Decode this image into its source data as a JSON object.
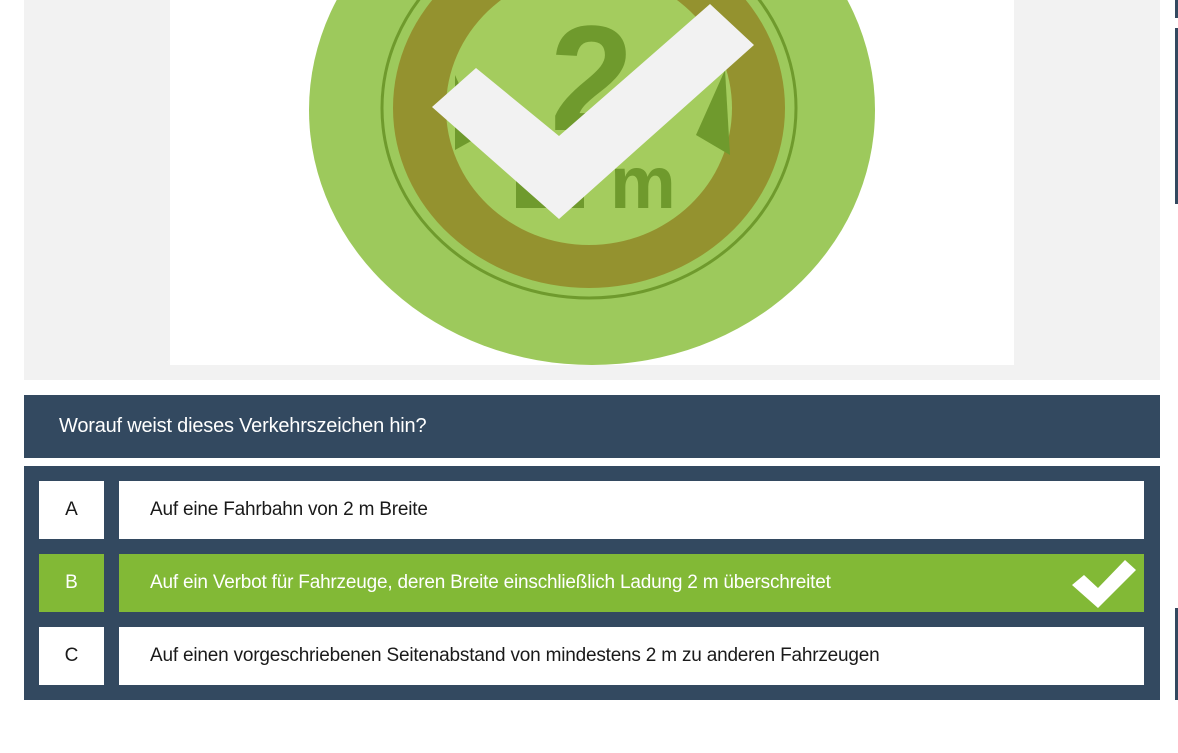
{
  "sign_image": {
    "sign_text_number": "2",
    "sign_text_unit": "m",
    "overlay_icon": "checkmark-icon",
    "colors": {
      "disc": "#9dc95c",
      "ring": "#94922f",
      "inner": "#a4cc5e",
      "glyph": "#6f9a2d",
      "check": "#f2f2f2"
    }
  },
  "question": {
    "text": "Worauf weist dieses Verkehrszeichen hin?"
  },
  "answers": [
    {
      "letter": "A",
      "text": "Auf eine Fahrbahn von 2 m Breite",
      "selected_correct": false
    },
    {
      "letter": "B",
      "text": "Auf ein Verbot für Fahrzeuge, deren Breite einschließlich Ladung 2 m überschreitet",
      "selected_correct": true,
      "status_icon": "checkmark-icon"
    },
    {
      "letter": "C",
      "text": "Auf einen vorgeschriebenen Seitenabstand von mindestens 2 m zu anderen Fahrzeugen",
      "selected_correct": false
    }
  ],
  "colors": {
    "panel_bg": "#334960",
    "correct_bg": "#82b936",
    "image_bg": "#f2f2f2"
  }
}
